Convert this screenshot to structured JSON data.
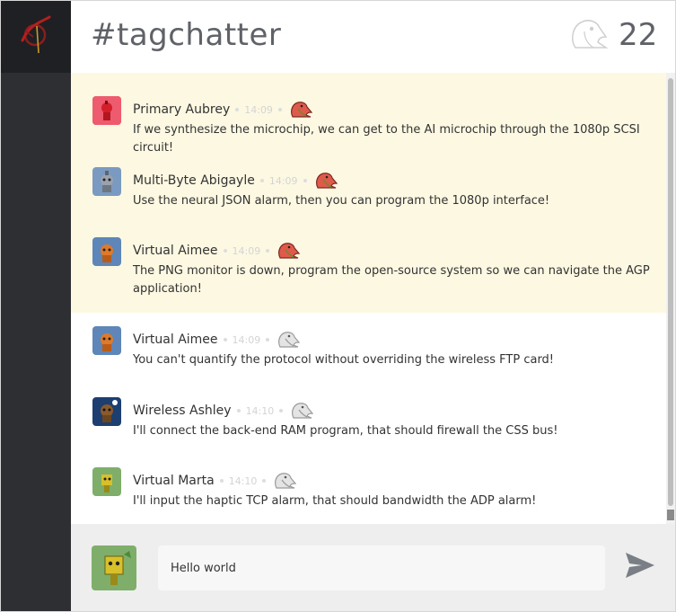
{
  "app": {
    "channel": "#tagchatter",
    "online_count": "22"
  },
  "colors": {
    "sidebar": "#2d2f33",
    "highlight": "#fdf8e2",
    "bird_active": "#e05a4c",
    "bird_inactive": "#b8b8b8"
  },
  "messages": [
    {
      "author": "Primary Aubrey",
      "time": "14:09",
      "text": "If we synthesize the microchip, we can get to the AI microchip through the 1080p SCSI circuit!",
      "highlighted": true,
      "bird": "bird-red-icon"
    },
    {
      "author": "Multi-Byte Abigayle",
      "time": "14:09",
      "text": "Use the neural JSON alarm, then you can program the 1080p interface!",
      "highlighted": true,
      "bird": "bird-red-icon"
    },
    {
      "author": "Virtual Aimee",
      "time": "14:09",
      "text": "The PNG monitor is down, program the open-source system so we can navigate the AGP application!",
      "highlighted": true,
      "bird": "bird-red-icon"
    },
    {
      "author": "Virtual Aimee",
      "time": "14:09",
      "text": "You can't quantify the protocol without overriding the wireless FTP card!",
      "highlighted": false,
      "bird": "bird-gray-icon"
    },
    {
      "author": "Wireless Ashley",
      "time": "14:10",
      "text": "I'll connect the back-end RAM program, that should firewall the CSS bus!",
      "highlighted": false,
      "bird": "bird-gray-icon"
    },
    {
      "author": "Virtual Marta",
      "time": "14:10",
      "text": "I'll input the haptic TCP alarm, that should bandwidth the ADP alarm!",
      "highlighted": false,
      "bird": "bird-gray-icon"
    }
  ],
  "composer": {
    "value": "Hello world"
  }
}
